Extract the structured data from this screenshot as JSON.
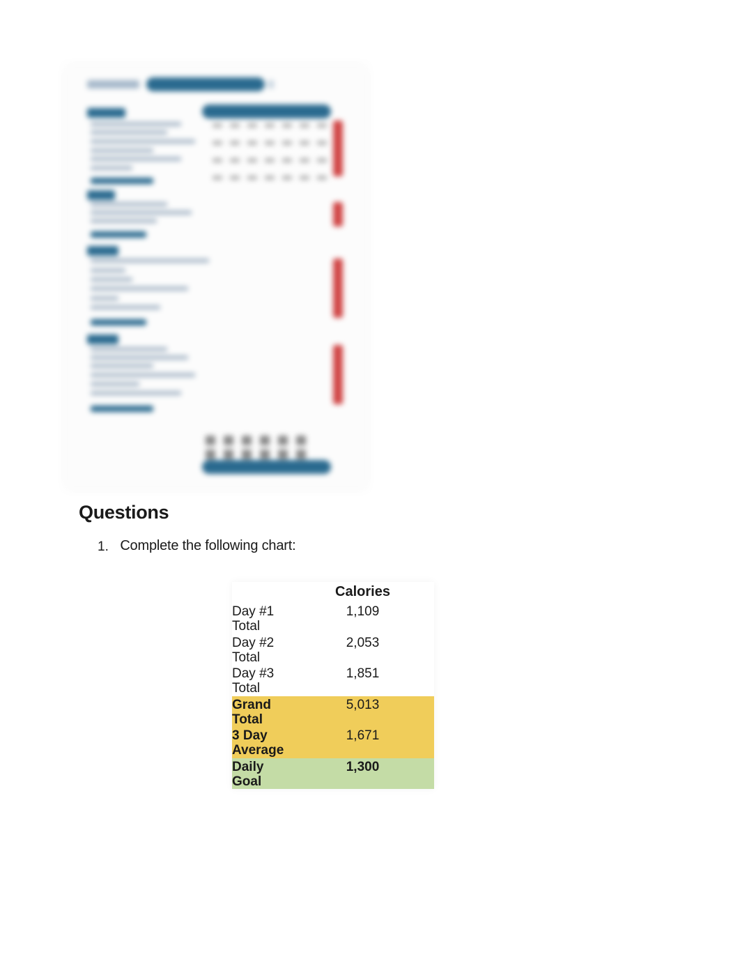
{
  "questions": {
    "heading": "Questions",
    "items": [
      {
        "number": "1.",
        "text": "Complete the following chart:"
      }
    ]
  },
  "chart_data": {
    "type": "table",
    "header": {
      "label": "",
      "value": "Calories"
    },
    "rows": [
      {
        "label": "Day #1 Total",
        "value": "1,109",
        "highlight": "none"
      },
      {
        "label": "Day #2 Total",
        "value": "2,053",
        "highlight": "none"
      },
      {
        "label": "Day #3 Total",
        "value": "1,851",
        "highlight": "none"
      },
      {
        "label": "Grand Total",
        "value": "5,013",
        "highlight": "yellow"
      },
      {
        "label": "3 Day Average",
        "value": "1,671",
        "highlight": "yellow"
      },
      {
        "label": "Daily Goal",
        "value": "1,300",
        "highlight": "green"
      }
    ]
  }
}
